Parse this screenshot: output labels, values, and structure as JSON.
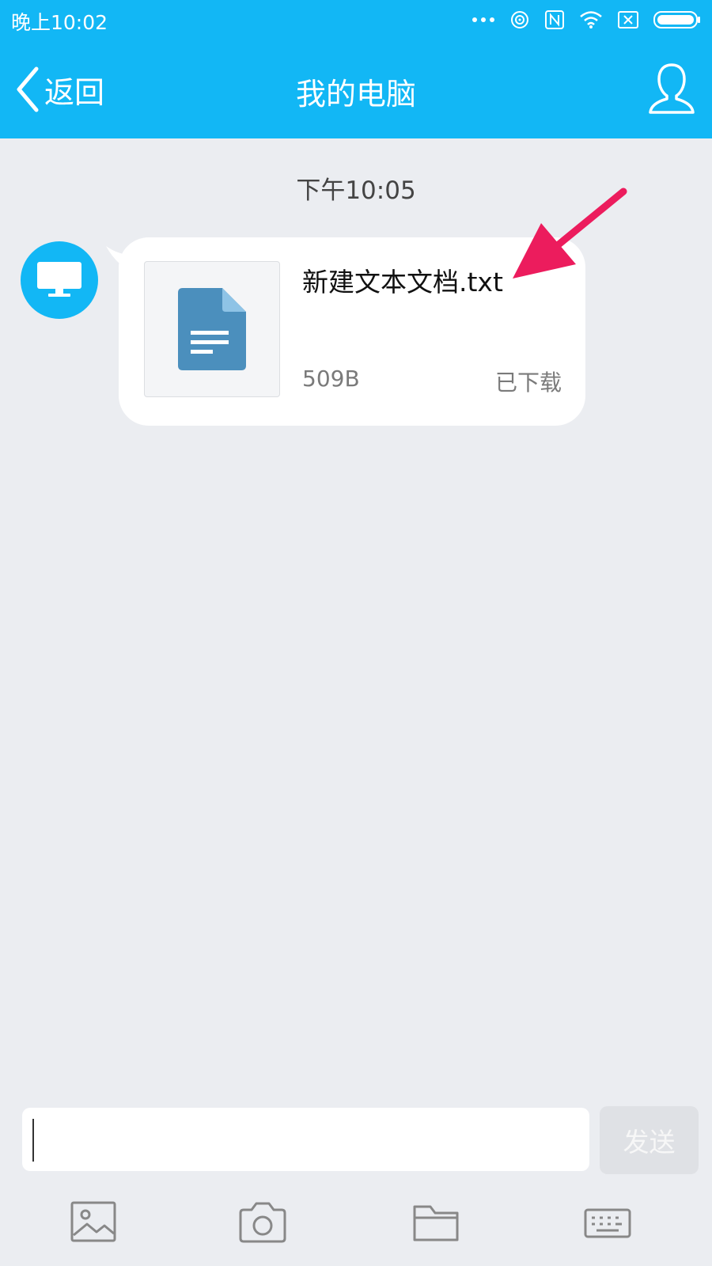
{
  "status_bar": {
    "time": "晚上10:02",
    "icons": [
      "more-dots-icon",
      "hotspot-icon",
      "nfc-icon",
      "wifi-icon",
      "sim-off-icon",
      "battery-icon"
    ]
  },
  "header": {
    "back_label": "返回",
    "title": "我的电脑",
    "profile_icon": "user-profile-icon",
    "background_color": "#12b7f5"
  },
  "chat": {
    "timestamp": "下午10:05",
    "messages": [
      {
        "sender_icon": "computer-monitor-icon",
        "type": "file",
        "file": {
          "icon": "document-icon",
          "name": "新建文本文档.txt",
          "size": "509B",
          "status": "已下载"
        }
      }
    ],
    "annotation_color": "#ec1c5d"
  },
  "composer": {
    "input_value": "",
    "send_label": "发送"
  },
  "toolbar": {
    "items": [
      "image-icon",
      "camera-icon",
      "folder-icon",
      "keyboard-icon"
    ]
  }
}
